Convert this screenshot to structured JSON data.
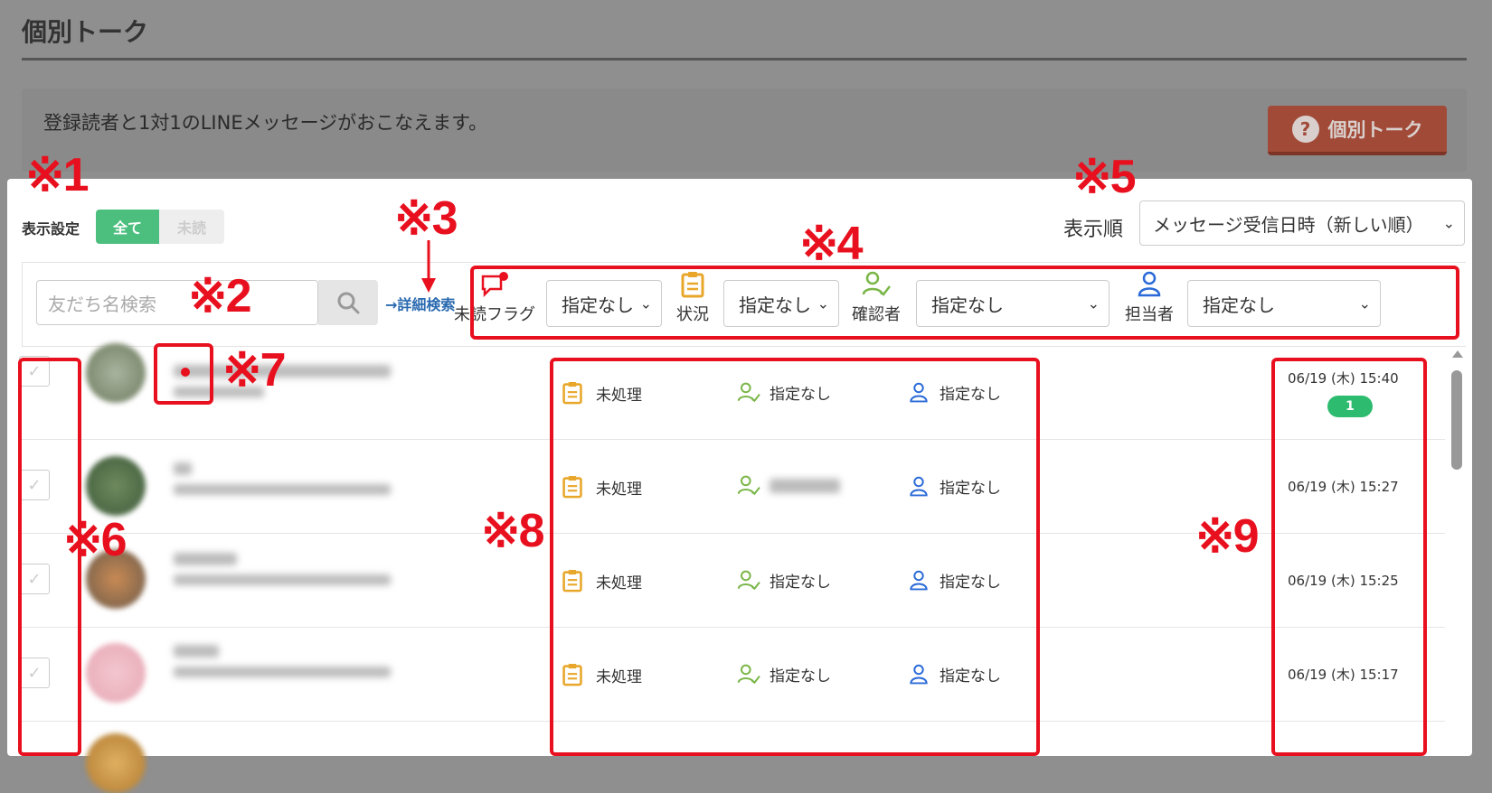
{
  "page": {
    "title": "個別トーク",
    "description": "登録読者と1対1のLINEメッセージがおこなえます。",
    "help_button": "個別トーク"
  },
  "display": {
    "label": "表示設定",
    "toggle_all": "全て",
    "toggle_unread": "未読"
  },
  "sort": {
    "label": "表示順",
    "value": "メッセージ受信日時（新しい順）"
  },
  "search": {
    "placeholder": "友だち名検索",
    "advanced_link": "→詳細検索"
  },
  "filters": {
    "unread_flag": {
      "label": "未読フラグ",
      "value": "指定なし"
    },
    "status": {
      "label": "状況",
      "value": "指定なし"
    },
    "confirmer": {
      "label": "確認者",
      "value": "指定なし"
    },
    "assignee": {
      "label": "担当者",
      "value": "指定なし"
    }
  },
  "rows": [
    {
      "status": "未処理",
      "confirmer": "指定なし",
      "assignee": "指定なし",
      "time": "06/19 (木) 15:40",
      "badge": "1"
    },
    {
      "status": "未処理",
      "confirmer": "",
      "assignee": "指定なし",
      "time": "06/19 (木) 15:27"
    },
    {
      "status": "未処理",
      "confirmer": "指定なし",
      "assignee": "指定なし",
      "time": "06/19 (木) 15:25"
    },
    {
      "status": "未処理",
      "confirmer": "指定なし",
      "assignee": "指定なし",
      "time": "06/19 (木) 15:17"
    }
  ],
  "annotations": {
    "a1": "※1",
    "a2": "※2",
    "a3": "※3",
    "a4": "※4",
    "a5": "※5",
    "a6": "※6",
    "a7": "※7",
    "a8": "※8",
    "a9": "※9"
  },
  "colors": {
    "accent_green": "#4cbf7f",
    "help_button": "#a24a38",
    "annotation_red": "#e8101e",
    "status_icon": "#e8a72a",
    "confirmer_icon": "#7ab648",
    "assignee_icon": "#2a6ad8"
  }
}
